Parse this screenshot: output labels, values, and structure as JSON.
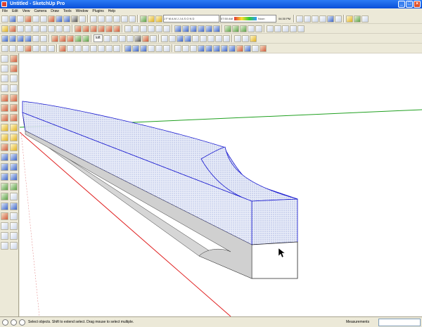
{
  "window": {
    "title": "Untitled - SketchUp Pro"
  },
  "menu": [
    "File",
    "Edit",
    "View",
    "Camera",
    "Draw",
    "Tools",
    "Window",
    "Plugins",
    "Help"
  ],
  "toolbar": {
    "shadow_time": "07:50 AM",
    "shadow_noon": "Noon",
    "shadow_pm": "04:30 PM",
    "shadow_months": "J F M A M J J A S O N D",
    "loft_label": "loft"
  },
  "status": {
    "hint": "Select objects. Shift to extend select. Drag mouse to select multiple.",
    "measurements_label": "Measurements",
    "measurements_value": ""
  },
  "colors": {
    "selection": "#0000ff",
    "axis_red": "#e02020",
    "axis_green": "#20a020",
    "face": "#e0e0e0"
  }
}
